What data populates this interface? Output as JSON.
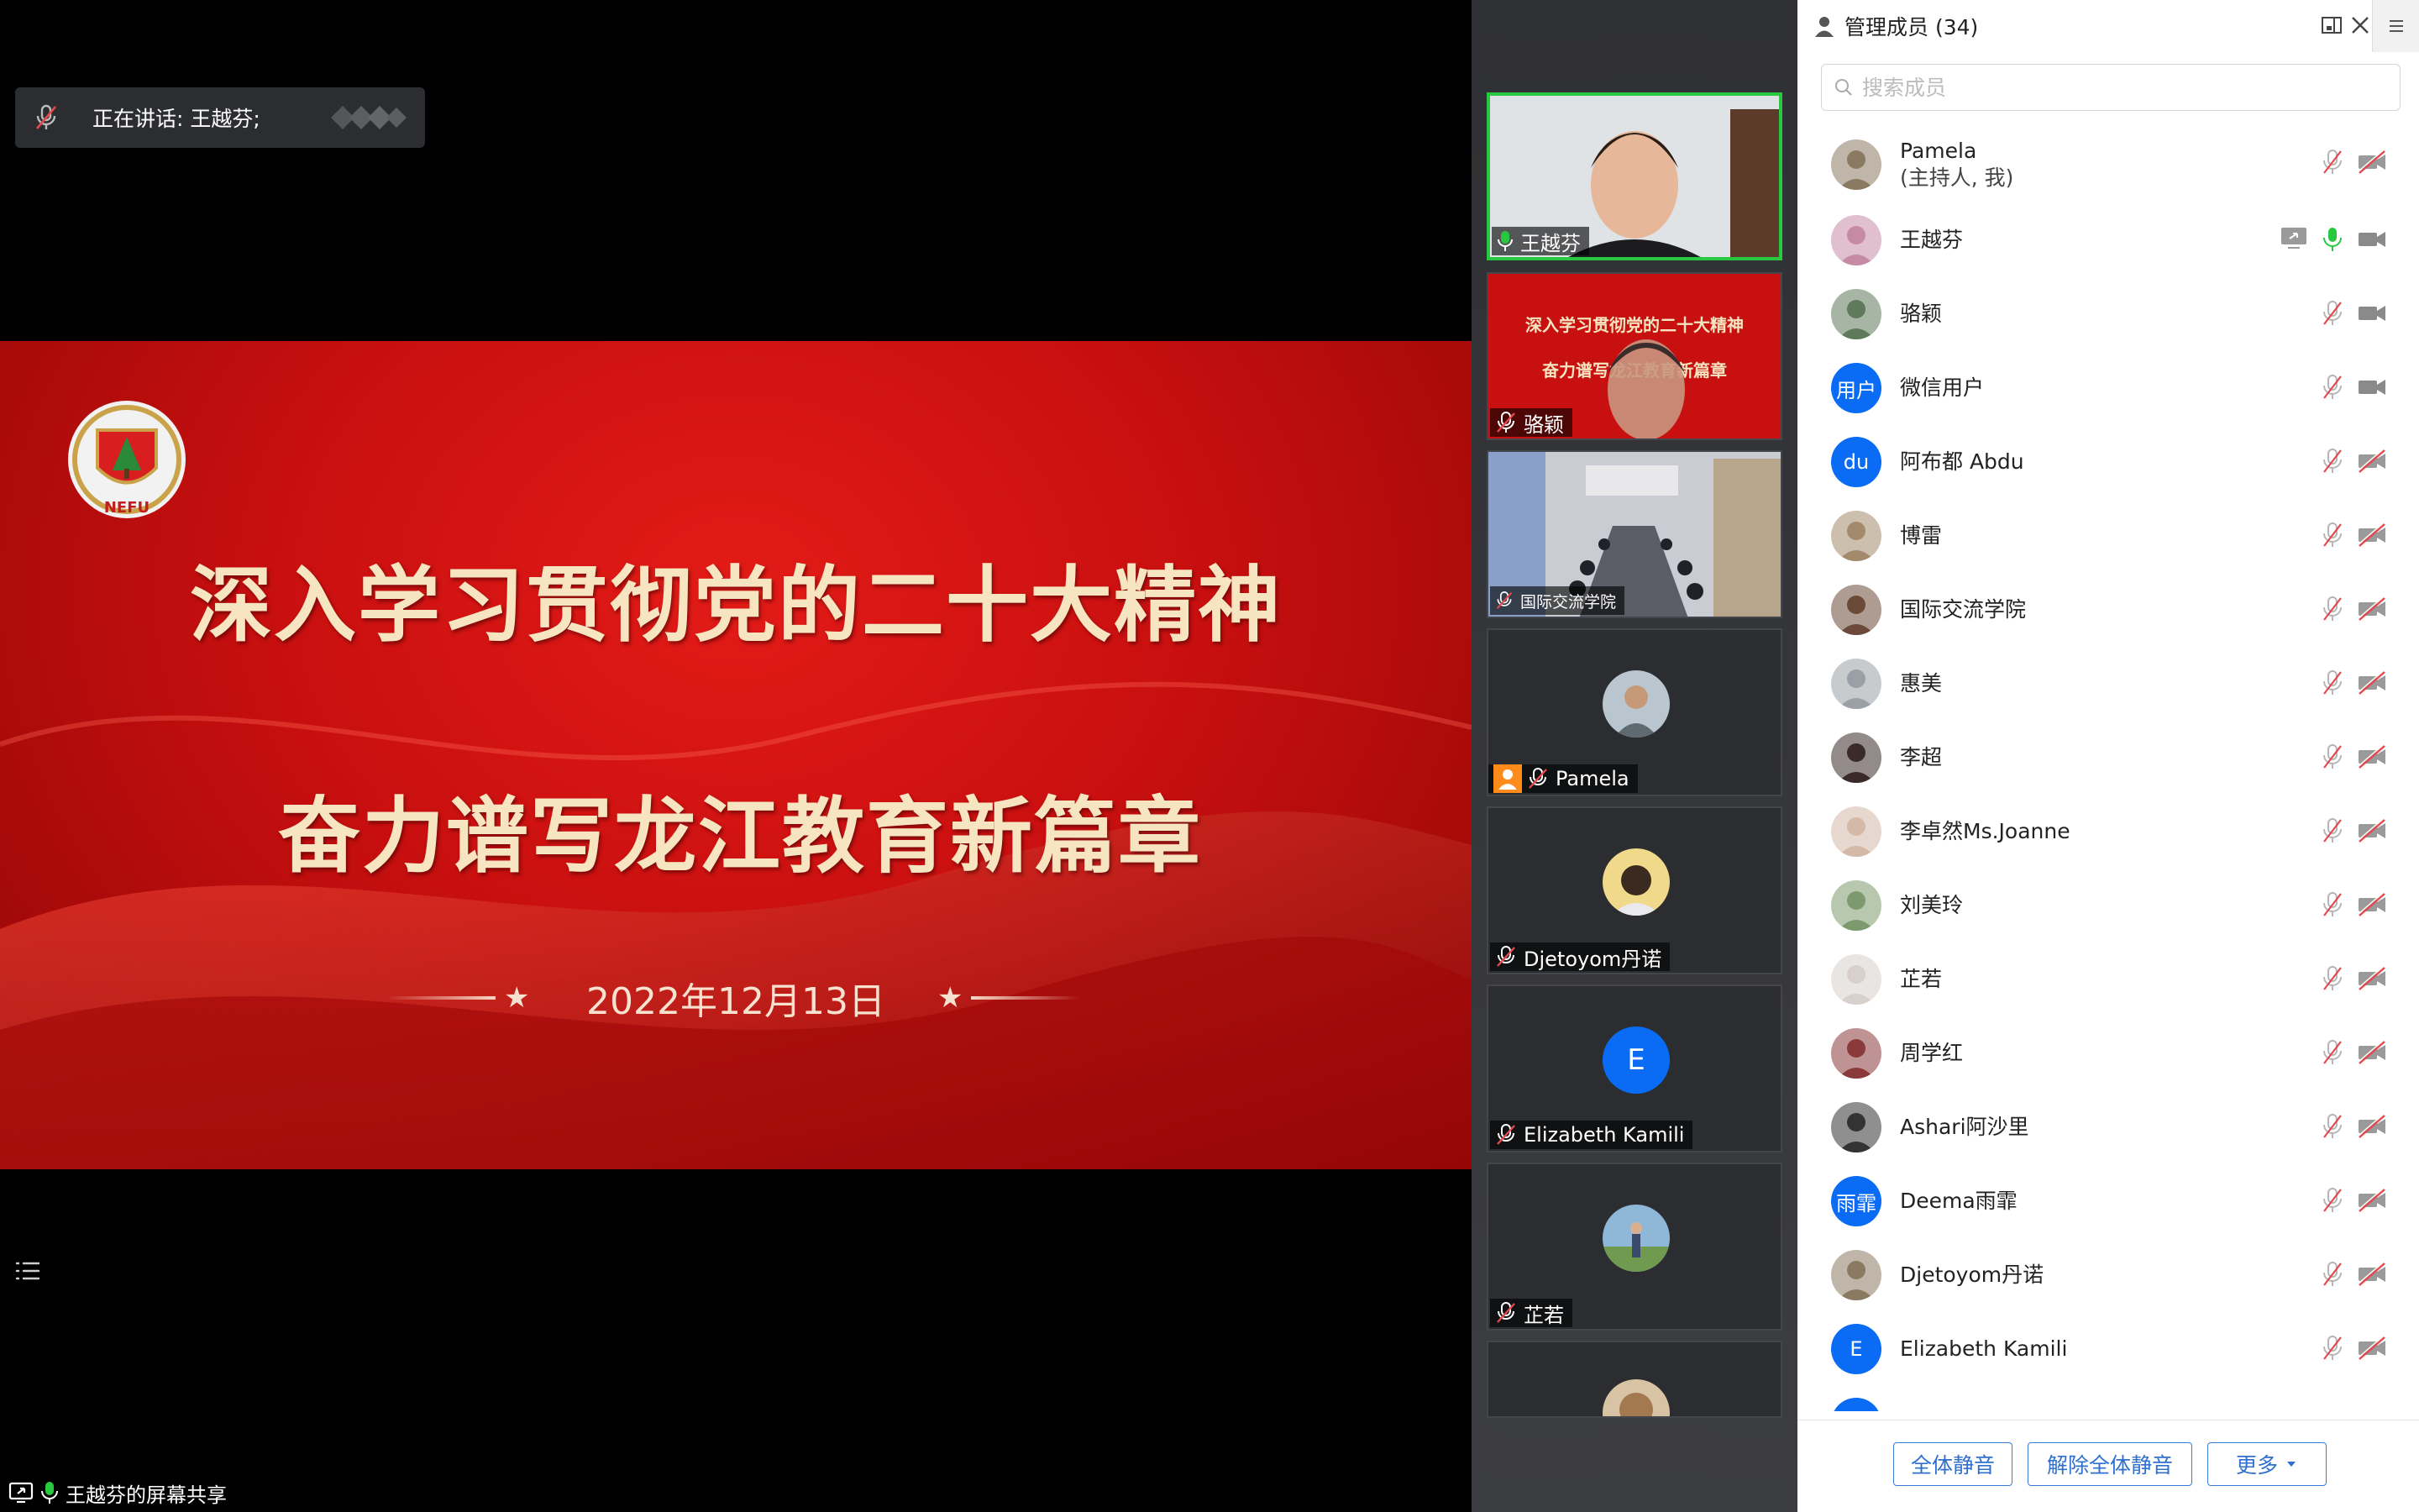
{
  "stage": {
    "speaking_label": "正在讲话: 王越芬;",
    "share_status": "王越芬的屏幕共享"
  },
  "slide": {
    "line1": "深入学习贯彻党的二十大精神",
    "line2": "奋力谱写龙江教育新篇章",
    "date": "2022年12月13日",
    "emblem_text": "NEFU"
  },
  "tiles": [
    {
      "name": "王越芬",
      "mic": "on",
      "active": true
    },
    {
      "name": "骆颖",
      "mic": "off"
    },
    {
      "name": "国际交流学院",
      "mic": "off"
    },
    {
      "name": "Pamela",
      "mic": "off",
      "host": true
    },
    {
      "name": "Djetoyom丹诺",
      "mic": "off"
    },
    {
      "name": "Elizabeth Kamili",
      "mic": "off",
      "letter": "E"
    },
    {
      "name": "芷若",
      "mic": "off"
    }
  ],
  "panel": {
    "title": "管理成员 (34)",
    "search_placeholder": "搜索成员",
    "members": [
      {
        "name": "Pamela",
        "sub": "(主持人, 我)",
        "mic": "off",
        "video": "off"
      },
      {
        "name": "王越芬",
        "mic": "on",
        "video": "on",
        "sharing": true
      },
      {
        "name": "骆颖",
        "mic": "off",
        "video": "on"
      },
      {
        "name": "微信用户",
        "letter": "用户",
        "mic": "off",
        "video": "on"
      },
      {
        "name": "阿布都 Abdu",
        "letter": "du",
        "mic": "off",
        "video": "off"
      },
      {
        "name": "博雷",
        "mic": "off",
        "video": "off"
      },
      {
        "name": "国际交流学院",
        "mic": "off",
        "video": "off"
      },
      {
        "name": "惠美",
        "mic": "off",
        "video": "off"
      },
      {
        "name": "李超",
        "mic": "off",
        "video": "off"
      },
      {
        "name": "李卓然Ms.Joanne",
        "mic": "off",
        "video": "off"
      },
      {
        "name": "刘美玲",
        "mic": "off",
        "video": "off"
      },
      {
        "name": "芷若",
        "mic": "off",
        "video": "off"
      },
      {
        "name": "周学红",
        "mic": "off",
        "video": "off"
      },
      {
        "name": "Ashari阿沙里",
        "mic": "off",
        "video": "off"
      },
      {
        "name": "Deema雨霏",
        "letter": "雨霏",
        "mic": "off",
        "video": "off"
      },
      {
        "name": "Djetoyom丹诺",
        "mic": "off",
        "video": "off"
      },
      {
        "name": "Elizabeth Kamili",
        "letter": "E",
        "mic": "off",
        "video": "off"
      }
    ],
    "buttons": {
      "mute_all": "全体静音",
      "unmute_all": "解除全体静音",
      "more": "更多"
    }
  },
  "colors": {
    "accent_green": "#28c840",
    "avatar_blue": "#0a6cf5",
    "button_blue": "#2f6fcf",
    "slide_red": "#c80f0f",
    "slide_gold": "#f6e5c0"
  }
}
